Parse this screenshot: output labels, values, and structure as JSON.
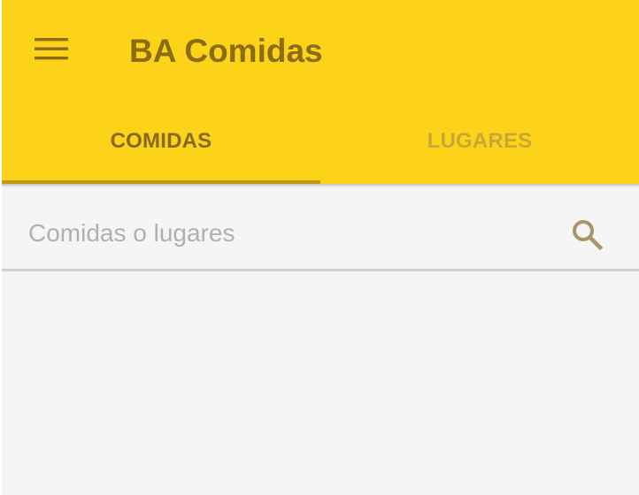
{
  "app": {
    "title": "BA Comidas"
  },
  "toolbar": {
    "menu_icon": "hamburger-menu-icon"
  },
  "tabs": [
    {
      "label": "COMIDAS",
      "selected": true
    },
    {
      "label": "LUGARES",
      "selected": false
    }
  ],
  "search": {
    "placeholder": "Comidas o lugares",
    "value": "",
    "icon": "search-icon"
  },
  "colors": {
    "appbar": "#fdd31a",
    "title_text": "#8a6c12",
    "tab_selected_text": "#846a1a",
    "tab_unselected_text": "#c9a832",
    "tab_indicator": "#c29a0e",
    "background": "#f5f5f3",
    "search_icon": "#a8956a"
  }
}
